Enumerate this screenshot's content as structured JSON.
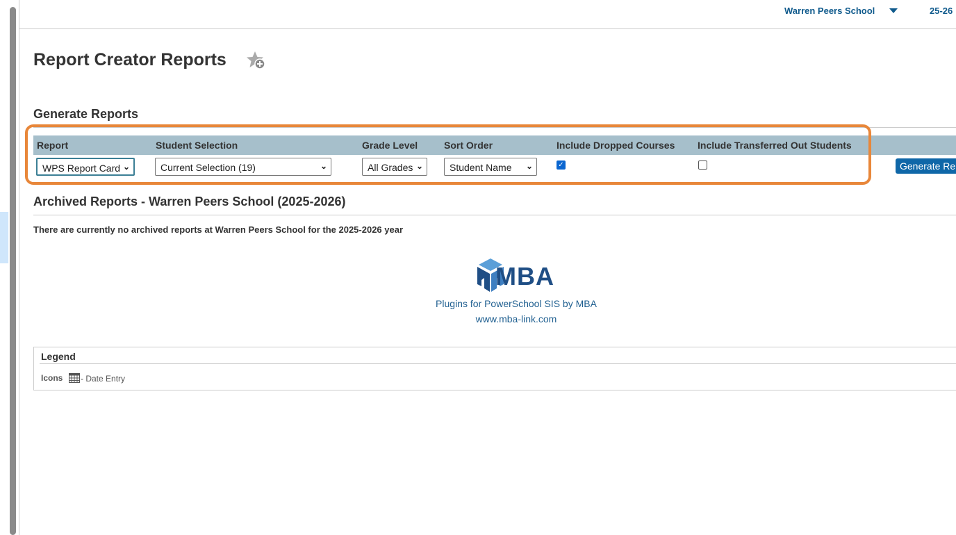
{
  "header": {
    "school": "Warren Peers School",
    "term": "25-26"
  },
  "page": {
    "title": "Report Creator Reports"
  },
  "generate": {
    "heading": "Generate Reports",
    "columns": [
      "Report",
      "Student Selection",
      "Grade Level",
      "Sort Order",
      "Include Dropped Courses",
      "Include Transferred Out Students"
    ],
    "report": "WPS Report Card",
    "student_selection": "Current Selection (19)",
    "grade_level": "All Grades",
    "sort_order": "Student Name",
    "include_dropped": true,
    "include_transferred": false,
    "button": "Generate Reports"
  },
  "archived": {
    "heading": "Archived Reports - Warren Peers School (2025-2026)",
    "note": "There are currently no archived reports at Warren Peers School for the 2025-2026 year"
  },
  "branding": {
    "logo": "MBA",
    "tagline": "Plugins for PowerSchool SIS by MBA",
    "url": "www.mba-link.com"
  },
  "legend": {
    "title": "Legend",
    "icons_label": "Icons",
    "date_entry": "- Date Entry"
  },
  "colors": {
    "highlight": "#e8873a",
    "header_bg": "#a6bfcb",
    "link": "#0f5a8c",
    "button": "#0f67a8"
  }
}
